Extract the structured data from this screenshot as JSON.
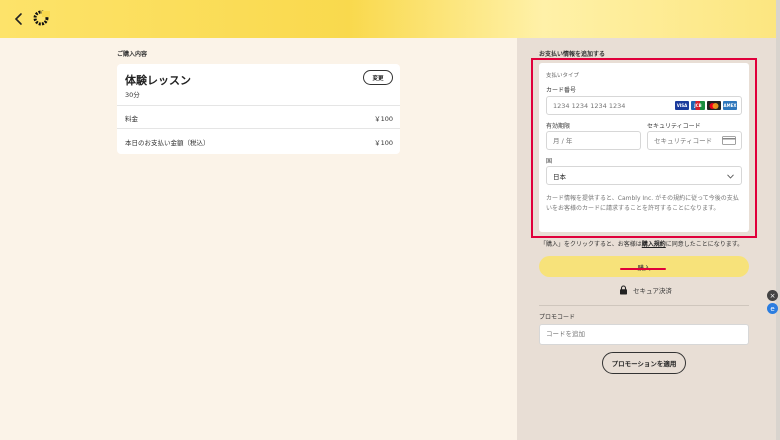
{
  "left": {
    "section_label": "ご購入内容",
    "card": {
      "title": "体験レッスン",
      "duration": "30分",
      "change_label": "変更",
      "fee_label": "料金",
      "fee_value": "￥100",
      "total_label": "本日のお支払い金額（税込）",
      "total_value": "￥100"
    }
  },
  "right": {
    "section_label": "お支払い情報を追加する",
    "payment": {
      "type_label": "支払いタイプ",
      "card_number_label": "カード番号",
      "card_number_placeholder": "1234 1234 1234 1234",
      "expiry_label": "有効期限",
      "expiry_placeholder": "月 / 年",
      "cvc_label": "セキュリティコード",
      "cvc_placeholder": "セキュリティコード",
      "country_label": "国",
      "country_value": "日本",
      "consent_text": "カード情報を提供すると、Cambly Inc. がその規約に従って今後の支払いをお客様のカードに請求することを許可することになります。",
      "brands": [
        "VISA",
        "JCB",
        "MC",
        "AMEX"
      ]
    },
    "purchase_note_pre": "「購入」をクリックすると、お客様は",
    "purchase_note_link": "購入規約",
    "purchase_note_post": "に同意したことになります。",
    "buy_label": "購入",
    "secure_label": "セキュア決済",
    "promo_label": "プロモコード",
    "promo_placeholder": "コードを追加",
    "promo_button_label": "プロモーションを適用"
  },
  "colors": {
    "accent_yellow": "#f7e27a",
    "highlight_red": "#e0003b",
    "panel_bg": "#e8ded5",
    "page_bg": "#fbf3e8"
  }
}
